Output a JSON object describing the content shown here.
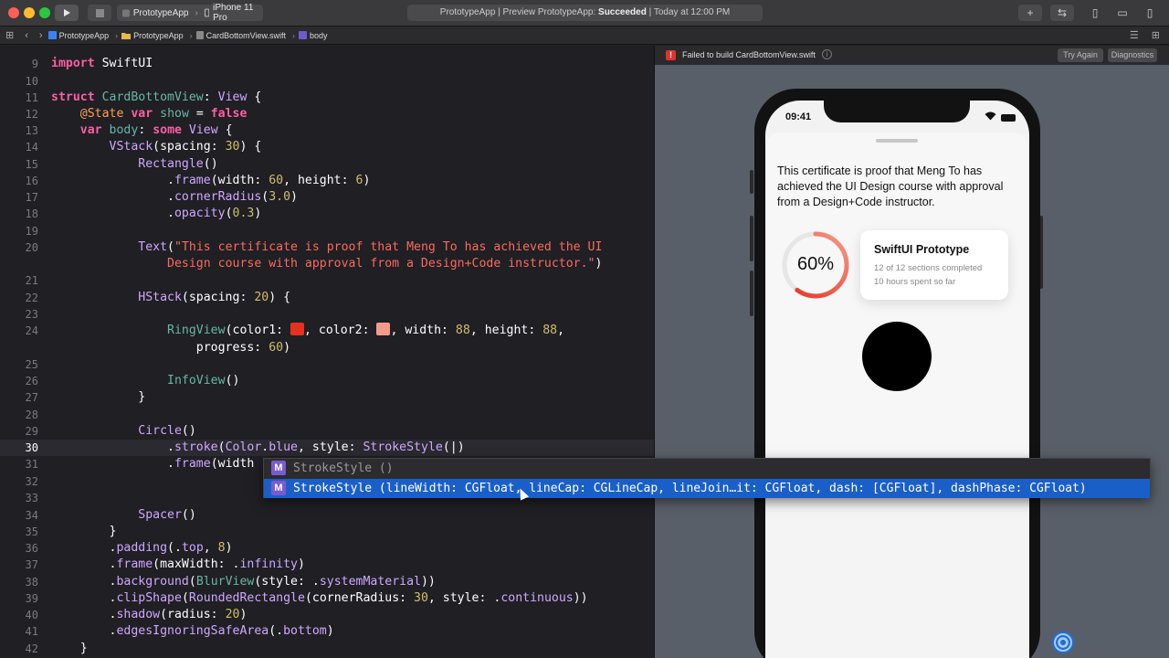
{
  "titlebar": {
    "scheme_app": "PrototypeApp",
    "scheme_device": "iPhone 11 Pro",
    "status_prefix": "PrototypeApp | Preview PrototypeApp: ",
    "status_result": "Succeeded",
    "status_time": " | Today at 12:00 PM"
  },
  "jumpbar": {
    "crumbs": [
      "PrototypeApp",
      "PrototypeApp",
      "CardBottomView.swift",
      "body"
    ]
  },
  "editor": {
    "lines": [
      {
        "n": "9"
      },
      {
        "n": "10"
      },
      {
        "n": "11"
      },
      {
        "n": "12"
      },
      {
        "n": "13"
      },
      {
        "n": "14"
      },
      {
        "n": "15"
      },
      {
        "n": "16"
      },
      {
        "n": "17"
      },
      {
        "n": "18"
      },
      {
        "n": "19"
      },
      {
        "n": "20"
      },
      {
        "n": "21"
      },
      {
        "n": "22"
      },
      {
        "n": "23"
      },
      {
        "n": "24"
      },
      {
        "n": "25"
      },
      {
        "n": "26"
      },
      {
        "n": "27"
      },
      {
        "n": "28"
      },
      {
        "n": "29"
      },
      {
        "n": "30"
      },
      {
        "n": "31"
      },
      {
        "n": "32"
      },
      {
        "n": "33"
      },
      {
        "n": "34"
      },
      {
        "n": "35"
      },
      {
        "n": "36"
      },
      {
        "n": "37"
      },
      {
        "n": "38"
      },
      {
        "n": "39"
      },
      {
        "n": "40"
      },
      {
        "n": "41"
      },
      {
        "n": "42"
      }
    ],
    "current_line": "30",
    "swatch_color1": "#e8301e",
    "swatch_color2": "#f39a8a"
  },
  "autocomplete": {
    "item1_badge": "M",
    "item1_name": "StrokeStyle",
    "item1_sig": " ()",
    "item2_badge": "M",
    "item2_name": "StrokeStyle",
    "item2_sig": " (lineWidth: CGFloat, lineCap: CGLineCap, lineJoin…it: CGFloat, dash: [CGFloat], dashPhase: CGFloat)"
  },
  "preview": {
    "error_badge": "!",
    "error_text": "Failed to build CardBottomView.swift",
    "info_glyph": "i",
    "try_again": "Try Again",
    "diagnostics": "Diagnostics"
  },
  "phone": {
    "time": "09:41",
    "certificate_text": "This certificate is proof that Meng To has achieved the UI Design course with approval from a Design+Code instructor.",
    "progress_percent": 60,
    "progress_label": "60%",
    "info_title": "SwiftUI Prototype",
    "info_line1": "12 of 12 sections completed",
    "info_line2": "10 hours spent so far"
  }
}
